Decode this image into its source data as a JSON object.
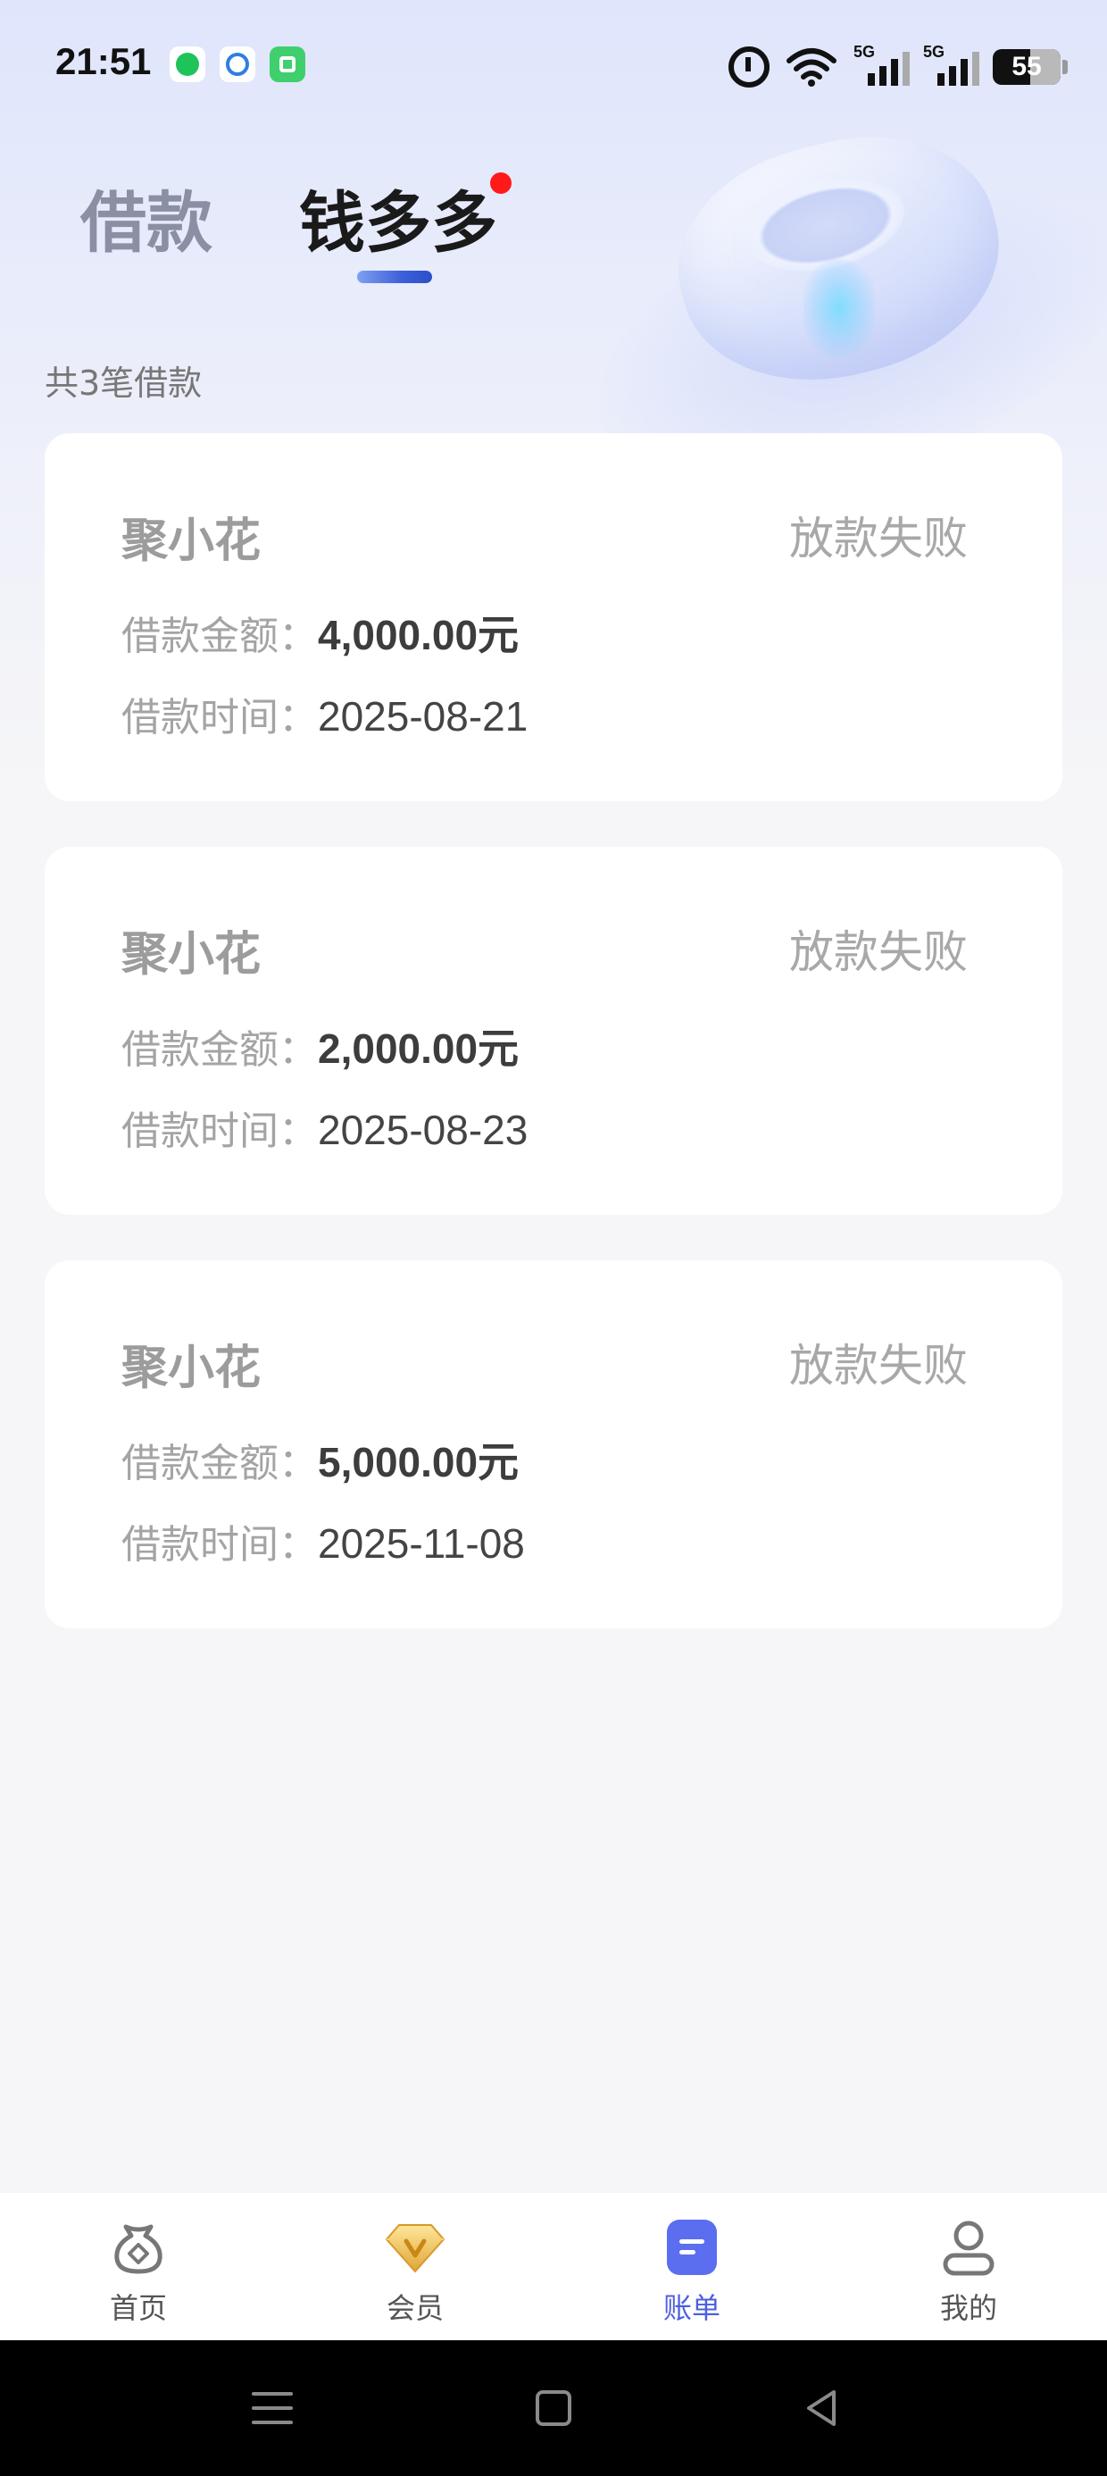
{
  "status_bar": {
    "time": "21:51",
    "signal1_label": "5G",
    "signal2_label": "5G",
    "battery": "55"
  },
  "tabs": [
    {
      "label": "借款",
      "active": false
    },
    {
      "label": "钱多多",
      "active": true,
      "has_badge_dot": true
    }
  ],
  "summary": {
    "count_text": "共3笔借款"
  },
  "loans": [
    {
      "product": "聚小花",
      "status": "放款失败",
      "amount_label": "借款金额：",
      "amount": "4,000.00元",
      "date_label": "借款时间：",
      "date": "2025-08-21"
    },
    {
      "product": "聚小花",
      "status": "放款失败",
      "amount_label": "借款金额：",
      "amount": "2,000.00元",
      "date_label": "借款时间：",
      "date": "2025-08-23"
    },
    {
      "product": "聚小花",
      "status": "放款失败",
      "amount_label": "借款金额：",
      "amount": "5,000.00元",
      "date_label": "借款时间：",
      "date": "2025-11-08"
    }
  ],
  "bottom_nav": [
    {
      "label": "首页",
      "icon": "money-bag-icon",
      "active": false
    },
    {
      "label": "会员",
      "icon": "diamond-v-icon",
      "active": false
    },
    {
      "label": "账单",
      "icon": "bill-icon",
      "active": true
    },
    {
      "label": "我的",
      "icon": "person-icon",
      "active": false
    }
  ],
  "colors": {
    "accent": "#4c5fe0",
    "badge_dot": "#ff1a1a",
    "card_bg": "#ffffff",
    "page_bg": "#f6f6f8"
  }
}
